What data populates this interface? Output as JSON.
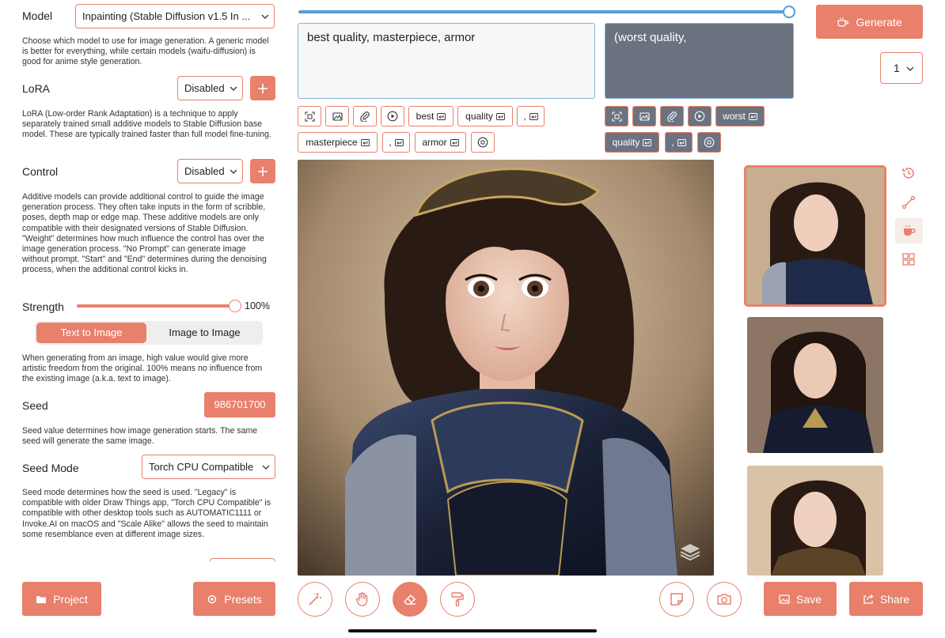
{
  "left": {
    "model": {
      "label": "Model",
      "value": "Inpainting (Stable Diffusion v1.5 In ...",
      "description": "Choose which model to use for image generation. A generic model is better for everything, while certain models (waifu-diffusion) is good for anime style generation."
    },
    "lora": {
      "label": "LoRA",
      "value": "Disabled",
      "description": "LoRA (Low-order Rank Adaptation) is a technique to apply separately trained small additive models to Stable Diffusion base model. These are typically trained faster than full model fine-tuning."
    },
    "control": {
      "label": "Control",
      "value": "Disabled",
      "description": "Additive models can provide additional control to guide the image generation process. They often take inputs in the form of scribble, poses, depth map or edge map. These additive models are only compatible with their designated versions of Stable Diffusion. \"Weight\" determines how much influence the control has over the image generation process. \"No Prompt\" can generate image without prompt. \"Start\" and \"End\" determines during the denoising process, when the additional control kicks in."
    },
    "strength": {
      "label": "Strength",
      "value_text": "100%",
      "value": 1.0,
      "mode_on": "Text to Image",
      "mode_off": "Image to Image",
      "description": "When generating from an image, high value would give more artistic freedom from the original. 100% means no influence from the existing image (a.k.a. text to image)."
    },
    "seed": {
      "label": "Seed",
      "value": "986701700",
      "description": "Seed value determines how image generation starts. The same seed will generate the same image."
    },
    "seed_mode": {
      "label": "Seed Mode",
      "value": "Torch CPU Compatible",
      "description": "Seed mode determines how the seed is used. \"Legacy\" is compatible with older Draw Things app, \"Torch CPU Compatible\" is compatible with other desktop tools such as AUTOMATIC1111 or Invoke.AI on macOS and \"Scale Alike\" allows the seed to maintain some resemblance even at different image sizes."
    }
  },
  "bottom": {
    "project": "Project",
    "presets": "Presets",
    "save": "Save",
    "share": "Share"
  },
  "top": {
    "progress": 1.0,
    "generate": "Generate",
    "batch_count": "1"
  },
  "prompt": {
    "positive": "best quality, masterpiece, armor",
    "negative": "(worst quality,",
    "positive_tokens_row1": [
      "best",
      "quality",
      ","
    ],
    "positive_tokens_row2": [
      "masterpiece",
      ",",
      "armor"
    ],
    "negative_tokens_row1": [
      "worst"
    ],
    "negative_tokens_row2": [
      "quality",
      ","
    ]
  },
  "colors": {
    "accent": "#e8806c",
    "negative_bg": "#6b7280"
  },
  "icons": {
    "select": "crop-select-icon",
    "image": "image-icon",
    "attach": "paperclip-icon",
    "play": "play-icon",
    "stop": "stop-icon",
    "history": "history-icon",
    "curve": "curve-icon",
    "cup": "teacup-icon",
    "grid": "grid-icon",
    "layers": "layers-icon"
  }
}
